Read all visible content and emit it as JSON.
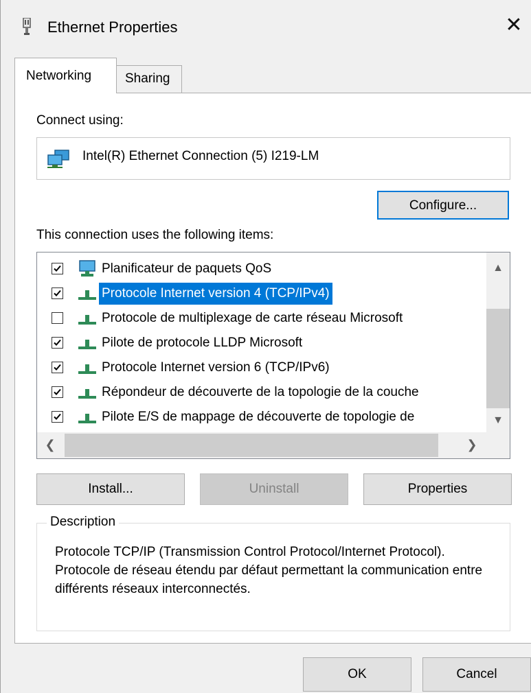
{
  "window": {
    "title": "Ethernet Properties",
    "close_label": "✕"
  },
  "tabs": [
    {
      "label": "Networking",
      "active": true
    },
    {
      "label": "Sharing",
      "active": false
    }
  ],
  "connect_using": {
    "label": "Connect using:",
    "adapter_name": "Intel(R) Ethernet Connection (5) I219-LM",
    "configure_label": "Configure..."
  },
  "items_list": {
    "label": "This connection uses the following items:",
    "items": [
      {
        "label": "Planificateur de paquets QoS",
        "checked": true,
        "selected": false,
        "icon": "network-monitor-icon"
      },
      {
        "label": "Protocole Internet version 4 (TCP/IPv4)",
        "checked": true,
        "selected": true,
        "icon": "protocol-icon"
      },
      {
        "label": "Protocole de multiplexage de carte réseau Microsoft",
        "checked": false,
        "selected": false,
        "icon": "protocol-icon"
      },
      {
        "label": "Pilote de protocole LLDP Microsoft",
        "checked": true,
        "selected": false,
        "icon": "protocol-icon"
      },
      {
        "label": "Protocole Internet version 6 (TCP/IPv6)",
        "checked": true,
        "selected": false,
        "icon": "protocol-icon"
      },
      {
        "label": "Répondeur de découverte de la topologie de la couche",
        "checked": true,
        "selected": false,
        "icon": "protocol-icon"
      },
      {
        "label": "Pilote E/S de mappage de découverte de topologie de",
        "checked": true,
        "selected": false,
        "icon": "protocol-icon"
      }
    ]
  },
  "buttons": {
    "install": "Install...",
    "uninstall": "Uninstall",
    "properties": "Properties",
    "ok": "OK",
    "cancel": "Cancel"
  },
  "description": {
    "legend": "Description",
    "text": "Protocole TCP/IP (Transmission Control Protocol/Internet Protocol). Protocole de réseau étendu par défaut permettant la communication entre différents réseaux interconnectés."
  },
  "colors": {
    "selection": "#0078d7",
    "focus_border": "#0078d7",
    "protocol_icon": "#2e8b57"
  }
}
